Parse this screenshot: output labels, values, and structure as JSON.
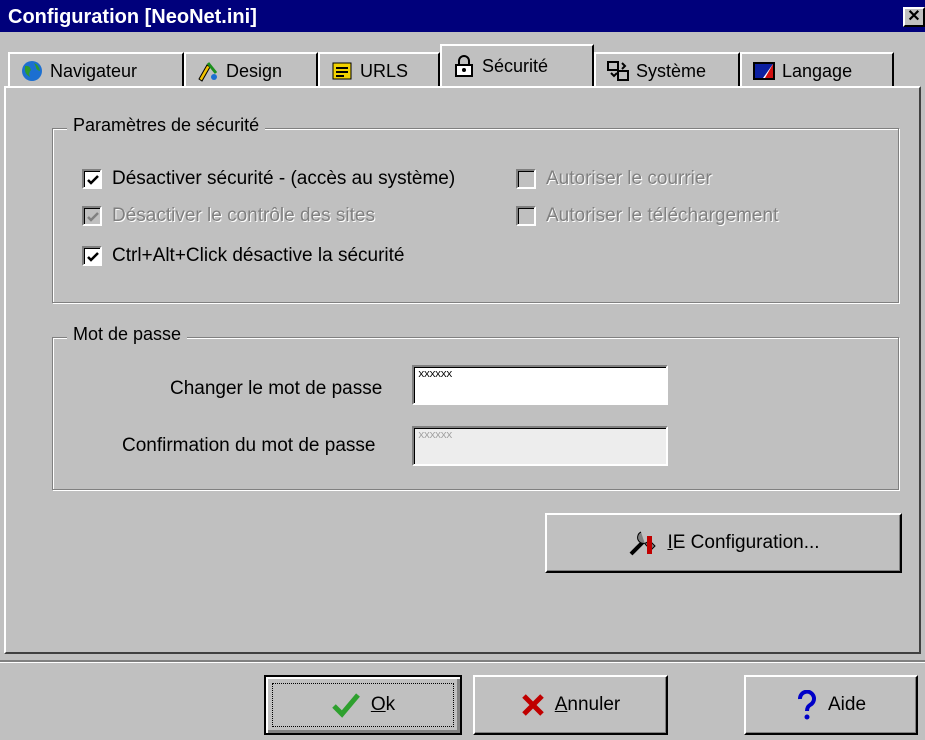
{
  "window": {
    "title": "Configuration [NeoNet.ini]",
    "close_label": "✕"
  },
  "tabs": [
    {
      "label": "Navigateur",
      "icon": "globe-icon"
    },
    {
      "label": "Design",
      "icon": "palette-icon"
    },
    {
      "label": "URLS",
      "icon": "url-list-icon"
    },
    {
      "label": "Sécurité",
      "icon": "lock-icon",
      "active": true
    },
    {
      "label": "Système",
      "icon": "system-icon"
    },
    {
      "label": "Langage",
      "icon": "flag-icon"
    }
  ],
  "security_group": {
    "title": "Paramètres de sécurité",
    "options": [
      {
        "label": "Désactiver sécurité - (accès au système)",
        "checked": true,
        "enabled": true
      },
      {
        "label": "Désactiver le contrôle des sites",
        "checked": true,
        "enabled": false
      },
      {
        "label": "Ctrl+Alt+Click désactive la sécurité",
        "checked": true,
        "enabled": true
      },
      {
        "label": "Autoriser le courrier",
        "checked": false,
        "enabled": false
      },
      {
        "label": "Autoriser le téléchargement",
        "checked": false,
        "enabled": false
      }
    ]
  },
  "password_group": {
    "title": "Mot de passe",
    "change_label": "Changer le mot de passe",
    "change_value": "xxxxxx",
    "confirm_label": "Confirmation du mot de passe",
    "confirm_value": "xxxxxx"
  },
  "ie_button": {
    "mnemonic": "I",
    "rest": "E Configuration..."
  },
  "buttons": {
    "ok": {
      "mnemonic": "O",
      "rest": "k"
    },
    "cancel": {
      "mnemonic": "A",
      "rest": "nnuler"
    },
    "help": {
      "label": "Aide"
    }
  },
  "colors": {
    "titlebar": "#00007b",
    "face": "#c0c0c0",
    "ok_check": "#2ea02e",
    "cancel_x": "#c00000",
    "help_icon": "#0000c8"
  }
}
